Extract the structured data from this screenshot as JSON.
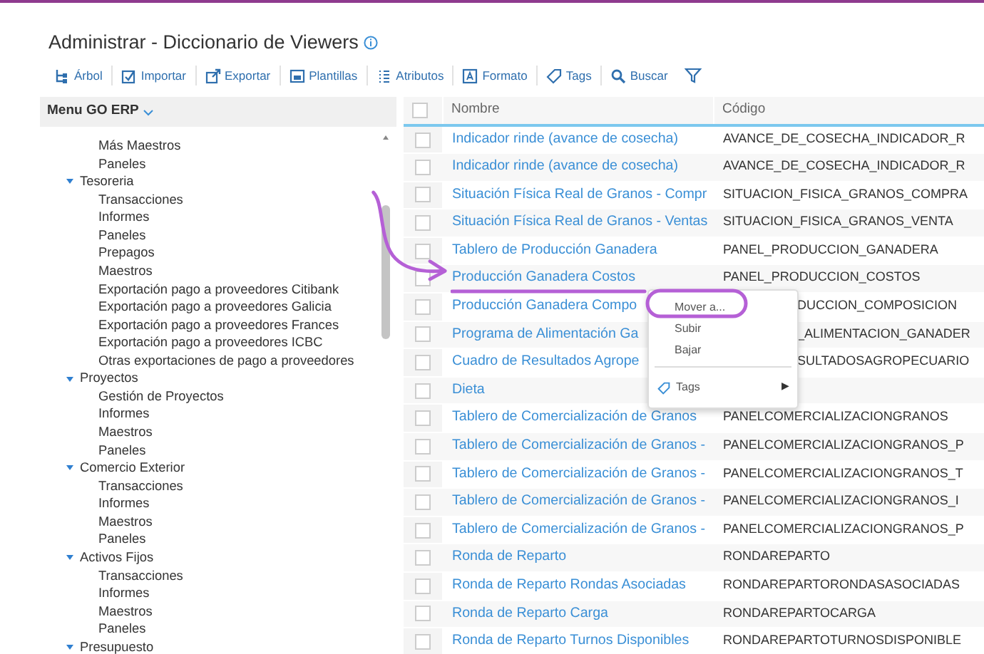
{
  "page": {
    "title": "Administrar - Diccionario de Viewers"
  },
  "toolbar": [
    {
      "kind": "tree",
      "label": "Árbol"
    },
    {
      "kind": "import",
      "label": "Importar"
    },
    {
      "kind": "export",
      "label": "Exportar"
    },
    {
      "kind": "template",
      "label": "Plantillas"
    },
    {
      "kind": "list",
      "label": "Atributos"
    },
    {
      "kind": "format",
      "label": "Formato"
    },
    {
      "kind": "tag",
      "label": "Tags"
    },
    {
      "kind": "search",
      "label": "Buscar"
    },
    {
      "kind": "filter"
    }
  ],
  "tree": {
    "title": "Menu GO ERP",
    "continued_children": [
      "Más Maestros",
      "Paneles"
    ],
    "items": [
      {
        "label": "Tesoreria",
        "expanded": true,
        "children": [
          {
            "label": "Transacciones"
          },
          {
            "label": "Informes"
          },
          {
            "label": "Paneles"
          },
          {
            "label": "Prepagos"
          },
          {
            "label": "Maestros"
          },
          {
            "label": "Exportación pago a proveedores Citibank"
          },
          {
            "label": "Exportación pago a proveedores Galicia"
          },
          {
            "label": "Exportación pago a proveedores Frances"
          },
          {
            "label": "Exportación pago a proveedores ICBC"
          },
          {
            "label": "Otras exportaciones de pago a proveedores"
          }
        ]
      },
      {
        "label": "Proyectos",
        "expanded": true,
        "children": [
          {
            "label": "Gestión de Proyectos"
          },
          {
            "label": "Informes"
          },
          {
            "label": "Maestros"
          },
          {
            "label": "Paneles"
          }
        ]
      },
      {
        "label": "Comercio Exterior",
        "expanded": true,
        "children": [
          {
            "label": "Transacciones"
          },
          {
            "label": "Informes"
          },
          {
            "label": "Maestros"
          },
          {
            "label": "Paneles"
          }
        ]
      },
      {
        "label": "Activos Fijos",
        "expanded": true,
        "children": [
          {
            "label": "Transacciones"
          },
          {
            "label": "Informes"
          },
          {
            "label": "Maestros"
          },
          {
            "label": "Paneles"
          }
        ]
      },
      {
        "label": "Presupuesto",
        "expanded": true
      }
    ]
  },
  "table": {
    "columns": [
      "Nombre",
      "Código"
    ],
    "all_checked": false,
    "rows": [
      {
        "name": "Indicador rinde (avance de cosecha)",
        "code": "AVANCE_DE_COSECHA_INDICADOR_R",
        "checked": false
      },
      {
        "name": "Indicador rinde (avance de cosecha)",
        "code": "AVANCE_DE_COSECHA_INDICADOR_R",
        "checked": false
      },
      {
        "name": "Situación Física Real de Granos - Compr",
        "code": "SITUACION_FISICA_GRANOS_COMPRA",
        "checked": false
      },
      {
        "name": "Situación Física Real de Granos - Ventas",
        "code": "SITUACION_FISICA_GRANOS_VENTA",
        "checked": false
      },
      {
        "name": "Tablero de Producción Ganadera",
        "code": "PANEL_PRODUCCION_GANADERA",
        "checked": false
      },
      {
        "name": "Producción Ganadera Costos",
        "code": "PANEL_PRODUCCION_COSTOS",
        "checked": false
      },
      {
        "name": "Producción Ganadera Compo",
        "code": "DUCCION_COMPOSICION",
        "covered": true,
        "checked": false
      },
      {
        "name": "Programa de Alimentación Ga",
        "code": "_ALIMENTACION_GANADER",
        "covered": true,
        "checked": false
      },
      {
        "name": "Cuadro de Resultados Agrope",
        "code": "SULTADOSAGROPECUARIO",
        "covered": true,
        "checked": false
      },
      {
        "name": "Dieta",
        "code": "",
        "checked": false
      },
      {
        "name": "Tablero de Comercialización de Granos",
        "code": "PANELCOMERCIALIZACIONGRANOS",
        "checked": false
      },
      {
        "name": "Tablero de Comercialización de Granos -",
        "code": "PANELCOMERCIALIZACIONGRANOS_P",
        "checked": false
      },
      {
        "name": "Tablero de Comercialización de Granos -",
        "code": "PANELCOMERCIALIZACIONGRANOS_T",
        "checked": false
      },
      {
        "name": "Tablero de Comercialización de Granos -",
        "code": "PANELCOMERCIALIZACIONGRANOS_I",
        "checked": false
      },
      {
        "name": "Tablero de Comercialización de Granos -",
        "code": "PANELCOMERCIALIZACIONGRANOS_P",
        "checked": false
      },
      {
        "name": "Ronda de Reparto",
        "code": "RONDAREPARTO",
        "checked": false
      },
      {
        "name": "Ronda de Reparto Rondas Asociadas",
        "code": "RONDAREPARTORONDASASOCIADAS",
        "checked": false
      },
      {
        "name": "Ronda de Reparto Carga",
        "code": "RONDAREPARTOCARGA",
        "checked": false
      },
      {
        "name": "Ronda de Reparto Turnos Disponibles",
        "code": "RONDAREPARTOTURNOSDISPONIBLE",
        "checked": false
      }
    ]
  },
  "context_menu": {
    "items": [
      {
        "kind": "item",
        "label": "Mover a..."
      },
      {
        "kind": "item",
        "label": "Subir"
      },
      {
        "kind": "item",
        "label": "Bajar"
      },
      {
        "kind": "divider"
      },
      {
        "kind": "submenu",
        "label": "Tags",
        "arrow": "▶"
      }
    ]
  }
}
